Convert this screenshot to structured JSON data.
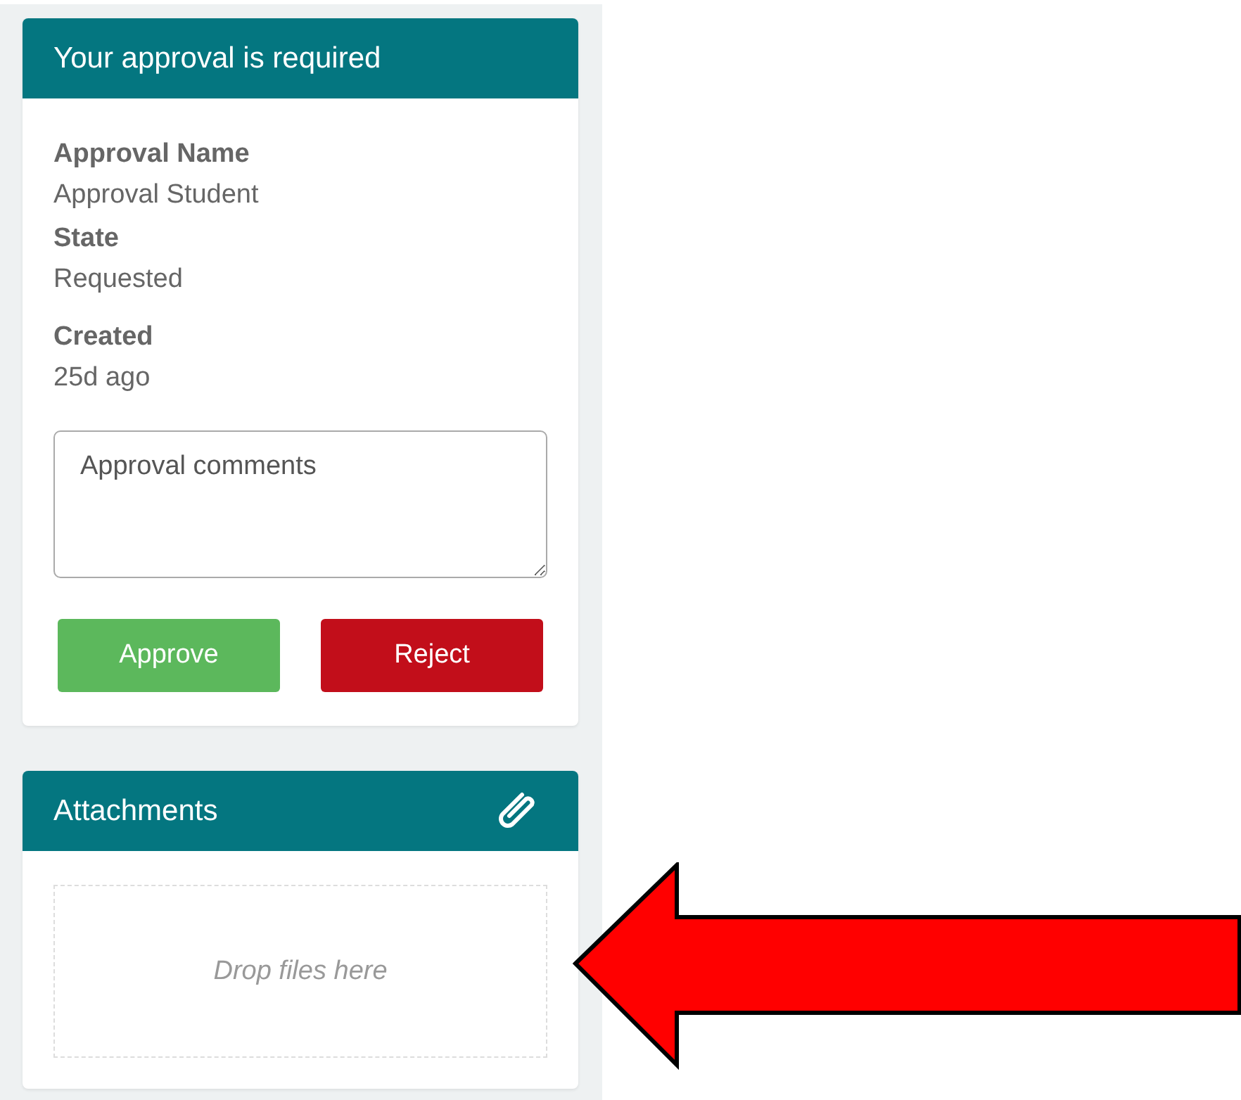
{
  "approval_card": {
    "title": "Your approval is required",
    "fields": [
      {
        "label": "Approval Name",
        "value": "Approval Student"
      },
      {
        "label": "State",
        "value": "Requested"
      },
      {
        "label": "Created",
        "value": "25d ago"
      }
    ],
    "comments": {
      "placeholder": "Approval comments"
    },
    "buttons": [
      {
        "kind": "approve",
        "label": "Approve"
      },
      {
        "kind": "reject",
        "label": "Reject"
      }
    ]
  },
  "attachments_card": {
    "title": "Attachments",
    "dropzone": {
      "placeholder": "Drop files here"
    }
  }
}
